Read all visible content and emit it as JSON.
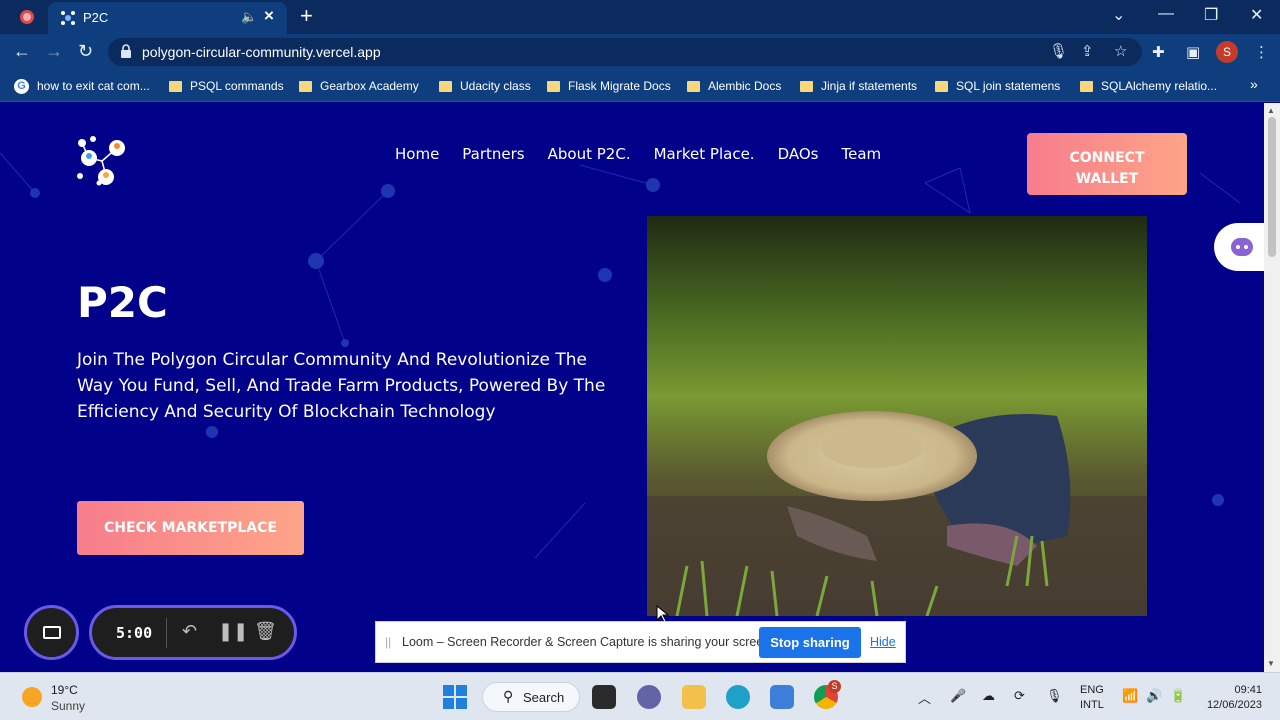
{
  "browser": {
    "tab_title": "P2C",
    "url": "polygon-circular-community.vercel.app",
    "profile_initial": "S",
    "bookmarks": [
      "how to exit cat com...",
      "PSQL commands",
      "Gearbox Academy",
      "Udacity class",
      "Flask Migrate Docs",
      "Alembic Docs",
      "Jinja if statements",
      "SQL join statemens",
      "SQLAlchemy relatio..."
    ],
    "more_bookmarks": "»"
  },
  "site": {
    "nav": [
      "Home",
      "Partners",
      "About P2C.",
      "Market Place.",
      "DAOs",
      "Team"
    ],
    "connect_label_line1": "CONNECT",
    "connect_label_line2": "WALLET",
    "hero_title": "P2C",
    "hero_text": "Join The Polygon Circular Community And Revolutionize The Way You Fund, Sell, And Trade Farm Products, Powered By The Efficiency And Security Of Blockchain Technology",
    "cta_label": "CHECK MARKETPLACE"
  },
  "loom": {
    "timer": "5:00",
    "share_message": "Loom – Screen Recorder & Screen Capture is sharing your screen.",
    "stop_label": "Stop sharing",
    "hide_label": "Hide"
  },
  "taskbar": {
    "temperature": "19°C",
    "condition": "Sunny",
    "search_label": "Search",
    "lang_line1": "ENG",
    "lang_line2": "INTL",
    "time": "09:41",
    "date": "12/06/2023",
    "chrome_badge": "S"
  },
  "colors": {
    "site_bg": "#01018a",
    "button_gradient_start": "#f77d8c",
    "button_gradient_end": "#fda488",
    "chrome_dark": "#0b2b5e",
    "chrome_mid": "#0f3e7e",
    "loom_purple": "#6b59e8"
  }
}
